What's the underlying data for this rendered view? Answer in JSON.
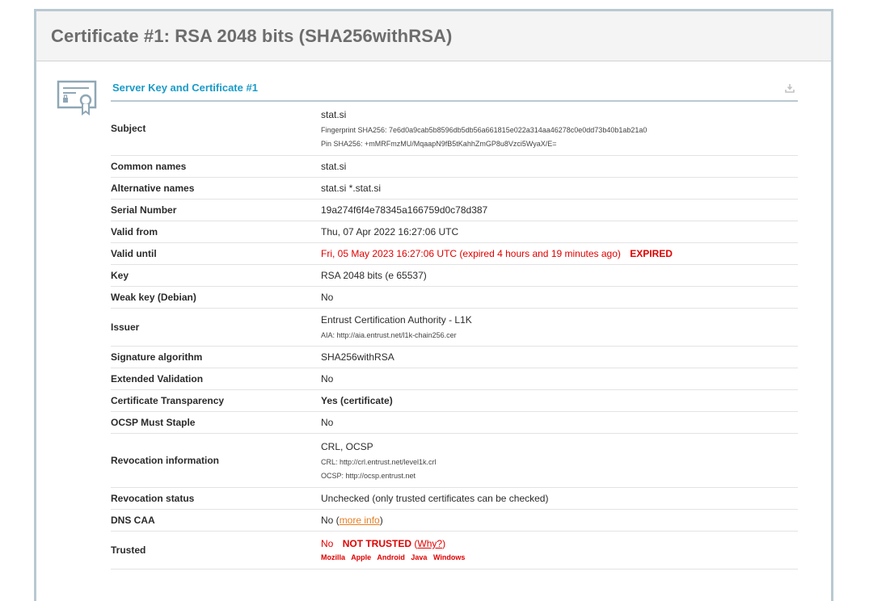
{
  "report": {
    "title": "Certificate #1: RSA 2048 bits (SHA256withRSA)"
  },
  "section": {
    "title": "Server Key and Certificate #1",
    "icon": "certificate-icon",
    "download_icon": "download-icon"
  },
  "rows": {
    "subject": {
      "label": "Subject",
      "value": "stat.si",
      "fingerprint": "Fingerprint SHA256: 7e6d0a9cab5b8596db5db56a661815e022a314aa46278c0e0dd73b40b1ab21a0",
      "pin": "Pin SHA256: +mMRFmzMU/MqaapN9fB5tKahhZmGP8u8Vzci5WyaX/E="
    },
    "common_names": {
      "label": "Common names",
      "value": "stat.si"
    },
    "alt_names": {
      "label": "Alternative names",
      "value": "stat.si *.stat.si"
    },
    "serial": {
      "label": "Serial Number",
      "value": "19a274f6f4e78345a166759d0c78d387"
    },
    "valid_from": {
      "label": "Valid from",
      "value": "Thu, 07 Apr 2022 16:27:06 UTC"
    },
    "valid_until": {
      "label": "Valid until",
      "value": "Fri, 05 May 2023 16:27:06 UTC (expired 4 hours and 19 minutes ago)",
      "badge": "EXPIRED"
    },
    "key": {
      "label": "Key",
      "value": "RSA 2048 bits (e 65537)"
    },
    "weak_key": {
      "label": "Weak key (Debian)",
      "value": "No"
    },
    "issuer": {
      "label": "Issuer",
      "value": "Entrust Certification Authority - L1K",
      "aia": "AIA: http://aia.entrust.net/l1k-chain256.cer"
    },
    "sig_alg": {
      "label": "Signature algorithm",
      "value": "SHA256withRSA"
    },
    "ev": {
      "label": "Extended Validation",
      "value": "No"
    },
    "ct": {
      "label": "Certificate Transparency",
      "value": "Yes (certificate)"
    },
    "ocsp_staple": {
      "label": "OCSP Must Staple",
      "value": "No"
    },
    "revocation_info": {
      "label": "Revocation information",
      "value": "CRL, OCSP",
      "crl": "CRL: http://crl.entrust.net/level1k.crl",
      "ocsp": "OCSP: http://ocsp.entrust.net"
    },
    "revocation_status": {
      "label": "Revocation status",
      "value": "Unchecked (only trusted certificates can be checked)"
    },
    "dns_caa": {
      "label": "DNS CAA",
      "value": "No",
      "link": "more info"
    },
    "trusted": {
      "label": "Trusted",
      "value": "No",
      "badge": "NOT TRUSTED",
      "link": "Why?",
      "browsers": [
        "Mozilla",
        "Apple",
        "Android",
        "Java",
        "Windows"
      ]
    }
  },
  "colors": {
    "accent": "#1a9bc8",
    "error": "#e00000",
    "ok": "#1e8a1e",
    "warn": "#e67e22",
    "frame": "#b9c9d1"
  }
}
